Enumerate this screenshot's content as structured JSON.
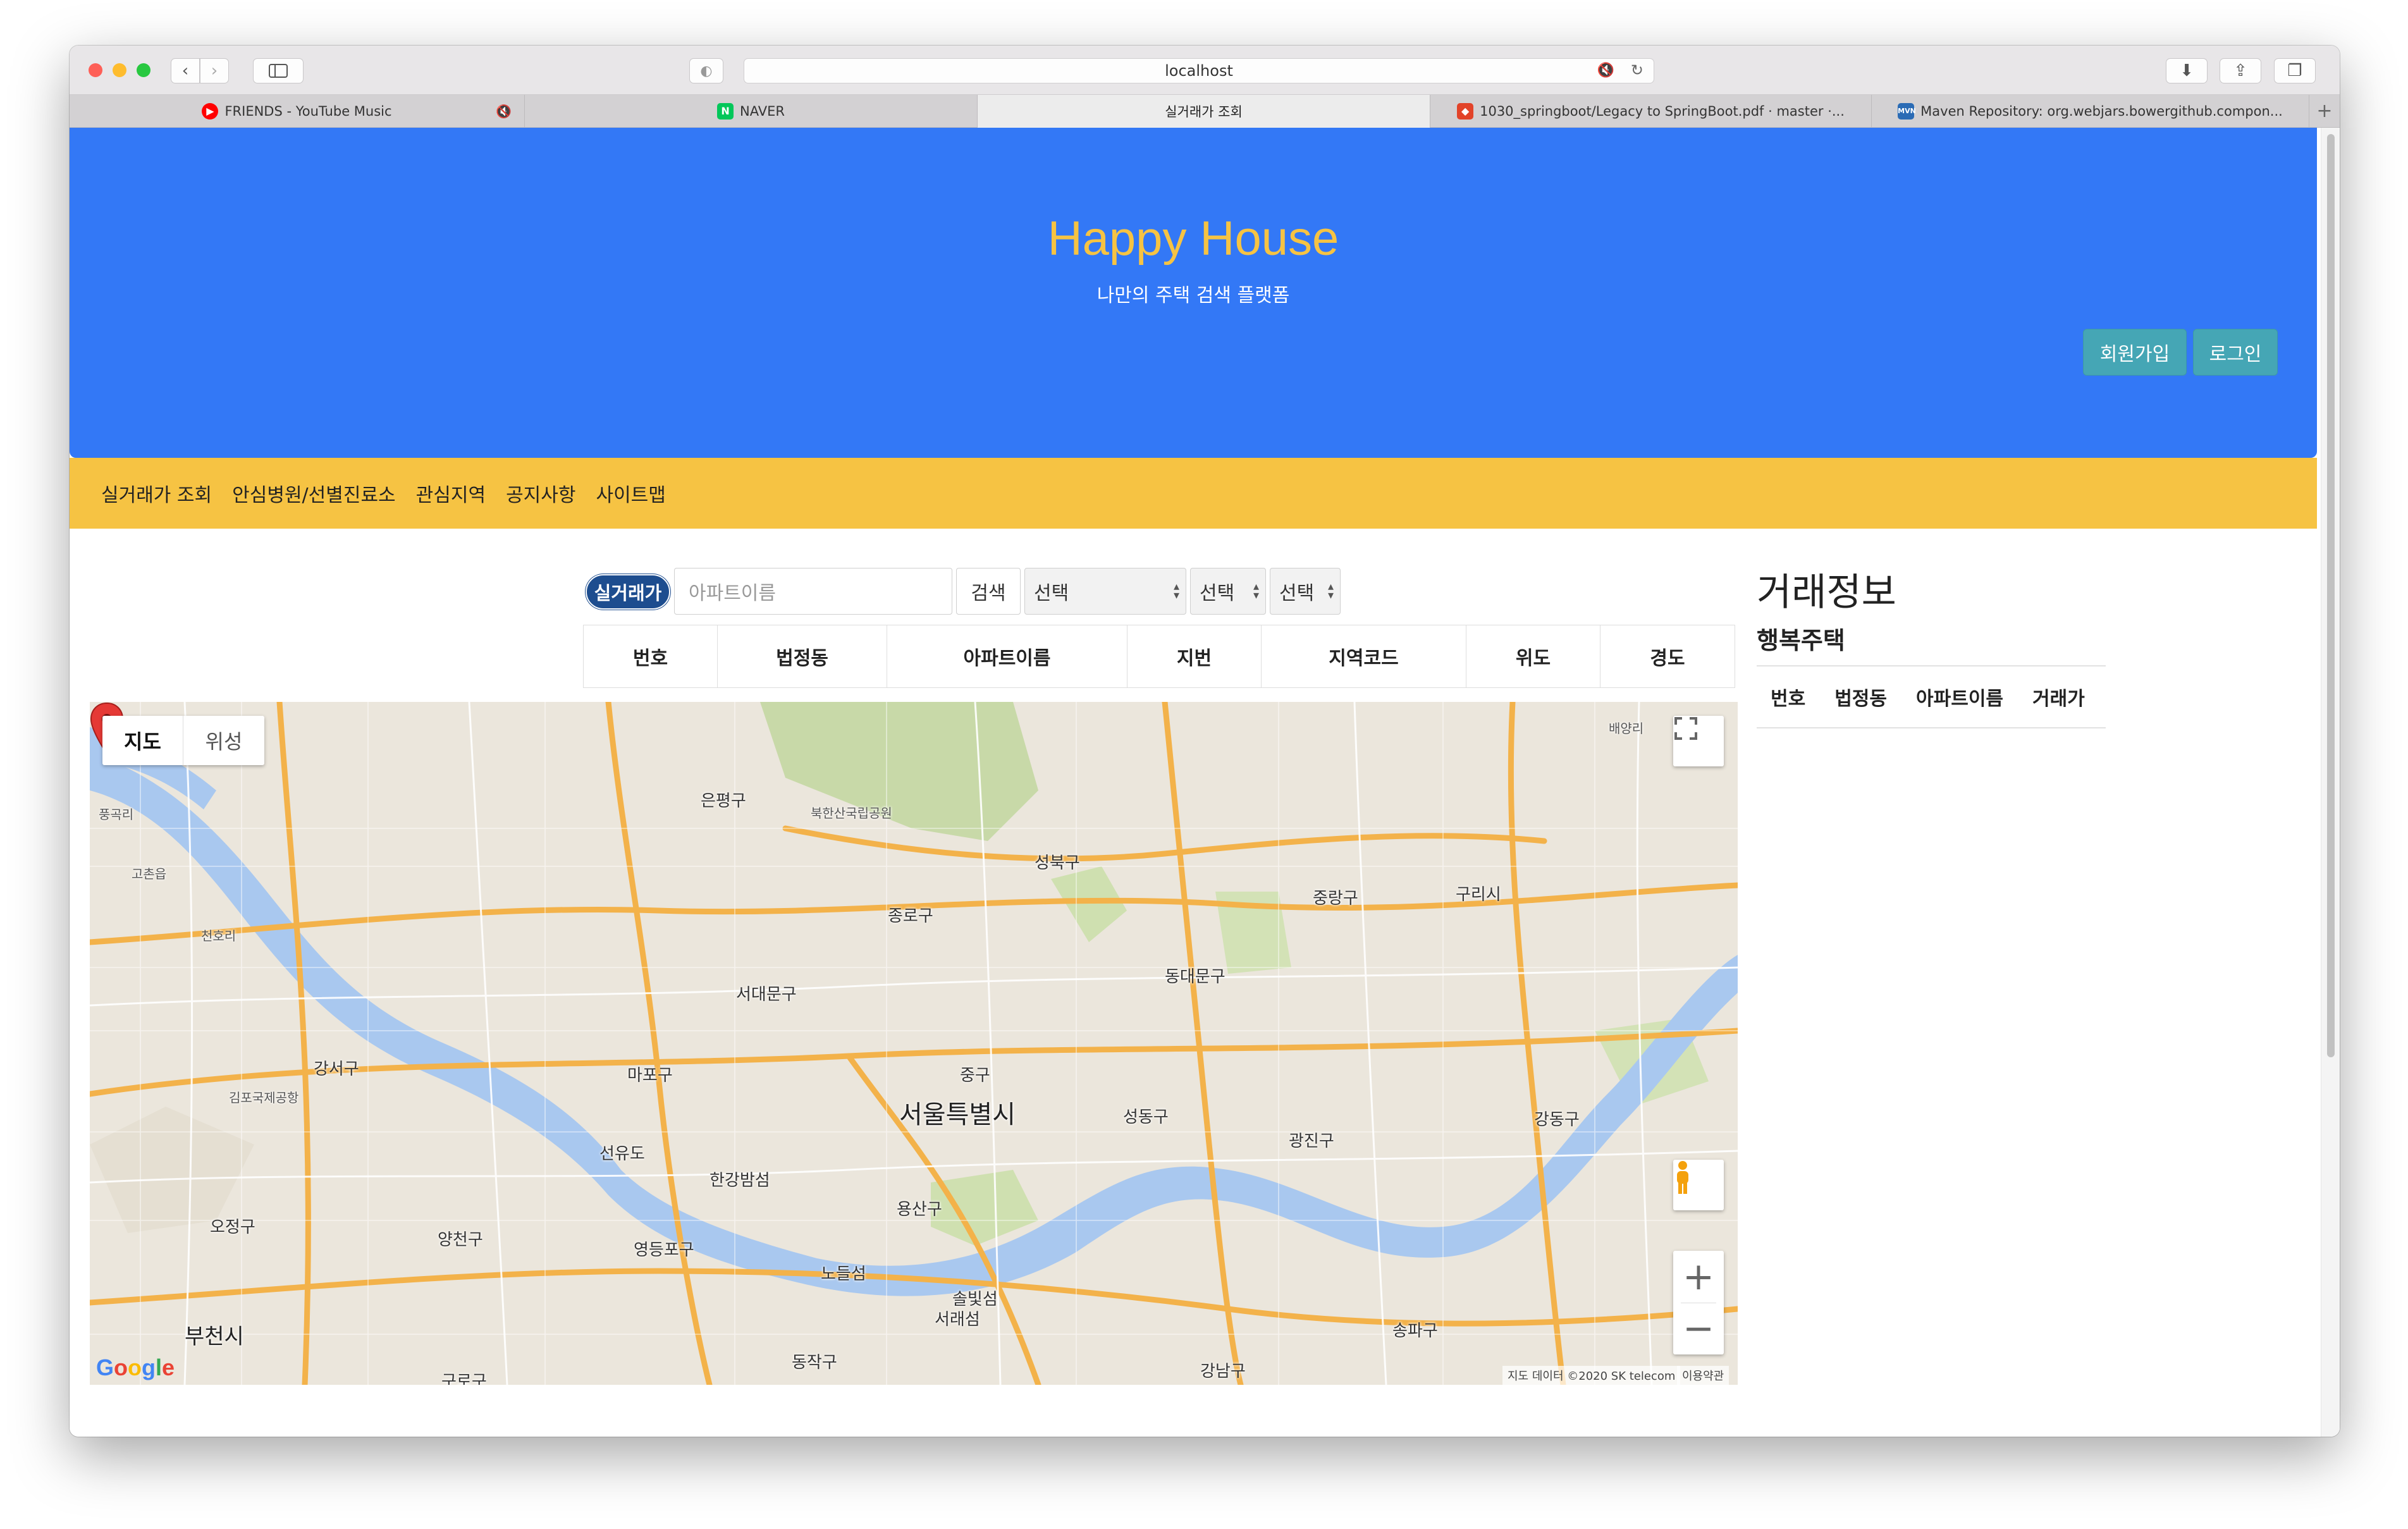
{
  "browser": {
    "address": "localhost",
    "tabs": [
      {
        "title": "FRIENDS - YouTube Music",
        "favicon": "youtube-music-icon",
        "muted": true
      },
      {
        "title": "NAVER",
        "favicon": "naver-icon"
      },
      {
        "title": "실거래가 조회",
        "active": true
      },
      {
        "title": "1030_springboot/Legacy to SpringBoot.pdf · master ·...",
        "favicon": "gitlab-icon"
      },
      {
        "title": "Maven Repository: org.webjars.bowergithub.compon...",
        "favicon": "mvn-icon"
      }
    ]
  },
  "hero": {
    "title": "Happy House",
    "subtitle": "나만의 주택 검색 플랫폼",
    "join_label": "회원가입",
    "login_label": "로그인",
    "bg_color": "#3378f6",
    "title_color": "#f6c343"
  },
  "nav": {
    "items": [
      "실거래가 조회",
      "안심병원/선별진료소",
      "관심지역",
      "공지사항",
      "사이트맵"
    ],
    "bg_color": "#f6c343"
  },
  "search": {
    "badge": "실거래가",
    "placeholder": "아파트이름",
    "button": "검색",
    "select1": "선택",
    "select2": "선택",
    "select3": "선택"
  },
  "apt_table": {
    "headers": [
      "번호",
      "법정동",
      "아파트이름",
      "지번",
      "지역코드",
      "위도",
      "경도"
    ]
  },
  "deal_panel": {
    "title": "거래정보",
    "subtitle": "행복주택",
    "headers": [
      "번호",
      "법정동",
      "아파트이름",
      "거래가"
    ]
  },
  "map": {
    "type_map": "지도",
    "type_satellite": "위성",
    "labels": {
      "seoul": "서울특별시",
      "gangseo": "강서구",
      "gimpo_airport": "김포국제공항",
      "mapo": "마포구",
      "eunpyeong": "은평구",
      "bukhansan": "북한산국립공원",
      "seongbuk": "성북구",
      "jongno": "종로구",
      "seodaemun": "서대문구",
      "jung": "중구",
      "dongdaemun": "동대문구",
      "jungnang": "중랑구",
      "guri": "구리시",
      "seongdong": "성동구",
      "gwangjin": "광진구",
      "gangdong": "강동구",
      "yongsan": "용산구",
      "seonyudo": "선유도",
      "hangang_bridge": "한강밤섬",
      "yangcheon": "양천구",
      "yeongdeungpo": "영등포구",
      "nodeulseom": "노들섬",
      "songpa": "송파구",
      "gangnam": "강남구",
      "bucheon": "부천시",
      "guro": "구로구",
      "dongjak": "동작구",
      "seorae": "서래섬",
      "solbit": "솔빛섬",
      "ojeong": "오정구",
      "goyang": "고촌읍",
      "pungmu": "풍곡리",
      "baemi": "배양리",
      "cheonho": "천호리"
    },
    "attribution": "지도 데이터 ©2020 SK telecom",
    "terms": "이용약관",
    "google": [
      "G",
      "o",
      "o",
      "g",
      "l",
      "e"
    ]
  }
}
